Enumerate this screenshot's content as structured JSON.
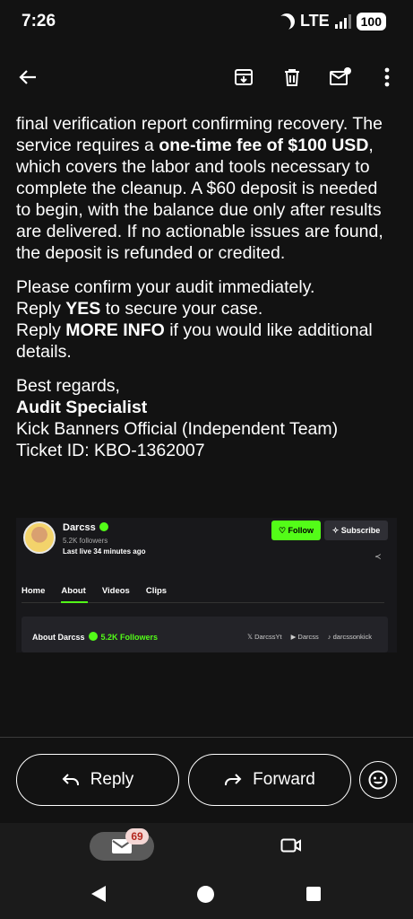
{
  "status_bar": {
    "time": "7:26",
    "network": "LTE",
    "battery": "100"
  },
  "toolbar": {
    "back_icon": "arrow-left-icon",
    "archive_icon": "archive-icon",
    "delete_icon": "trash-icon",
    "unread_icon": "mark-unread-icon",
    "more_icon": "more-vert-icon"
  },
  "email": {
    "para1_line1": "final verification report confirming recovery.",
    "para1_text1": "The service requires a ",
    "para1_bold1": "one-time fee of $100 USD",
    "para1_text2": ", which covers the labor and tools necessary to complete the cleanup. A $60 deposit is needed to begin, with the balance due only after results are delivered. If no actionable issues are found, the deposit is refunded or credited.",
    "para2_line1": "Please confirm your audit immediately.",
    "para2_reply1_a": "Reply ",
    "para2_reply1_b": "YES",
    "para2_reply1_c": " to secure your case.",
    "para2_reply2_a": "Reply ",
    "para2_reply2_b": "MORE INFO",
    "para2_reply2_c": " if you would like additional details.",
    "sign_regards": "Best regards,",
    "sign_name": "Audit Specialist",
    "sign_team": "Kick Banners Official (Independent Team)",
    "sign_ticket": "Ticket ID: KBO-1362007"
  },
  "embed": {
    "channel_name": "Darcss",
    "followers": "5.2K followers",
    "last_live": "Last live 34 minutes ago",
    "follow_label": "Follow",
    "subscribe_label": "Subscribe",
    "tabs": [
      "Home",
      "About",
      "Videos",
      "Clips"
    ],
    "about_title": "About Darcss",
    "about_followers": "5.2K Followers",
    "social_x": "DarcssYt",
    "social_yt": "Darcss",
    "social_tiktok": "darcssonkick",
    "accent": "#53fc18"
  },
  "actions": {
    "reply_label": "Reply",
    "forward_label": "Forward",
    "emoji_icon": "emoji-smile-icon"
  },
  "bottom_nav": {
    "mail_badge": "69",
    "mail_icon": "mail-icon",
    "video_icon": "video-camera-icon"
  }
}
